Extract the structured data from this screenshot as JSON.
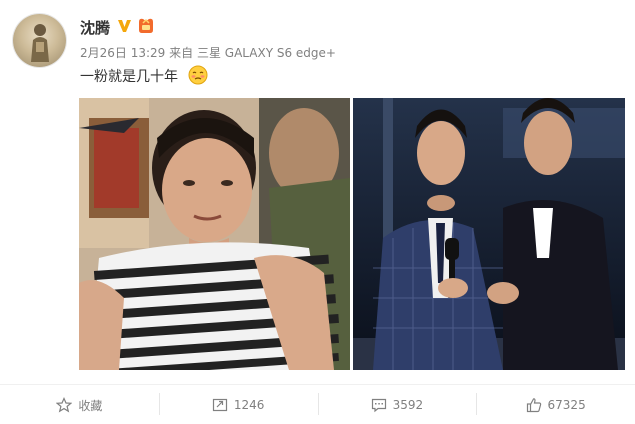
{
  "user": {
    "name": "沈腾",
    "avatar_icon": "avatar-icon",
    "verified_icon": "verified-v-icon",
    "badge_icon": "member-badge-icon"
  },
  "post": {
    "date": "2月26日 13:29",
    "source_prefix": "来自",
    "source": "三星 GALAXY S6 edge+",
    "text": "一粉就是几十年",
    "emoji_icon": "shy-face-emoji-icon"
  },
  "actions": {
    "favorite": {
      "label": "收藏",
      "icon": "star-icon"
    },
    "repost": {
      "label": "1246",
      "icon": "repost-icon"
    },
    "comment": {
      "label": "3592",
      "icon": "comment-icon"
    },
    "like": {
      "label": "67325",
      "icon": "thumbs-up-icon"
    }
  },
  "colors": {
    "verified": "#f4a70b",
    "text_meta": "#808080",
    "text_main": "#333333",
    "divider": "#e6e6e6"
  }
}
